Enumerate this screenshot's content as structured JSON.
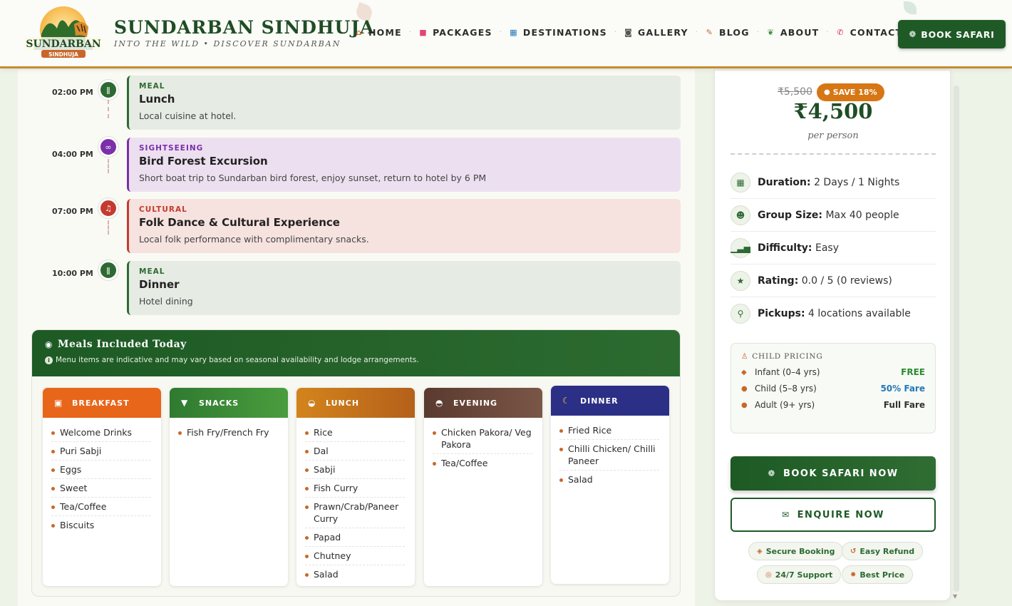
{
  "header": {
    "brand_name": "SUNDARBAN SINDHUJA",
    "brand_tagline": "INTO THE WILD  •  DISCOVER SUNDARBAN",
    "logo_text": "SUNDARBAN",
    "logo_subtext": "SINDHUJA",
    "nav": [
      {
        "label": "HOME",
        "icon": "home-icon"
      },
      {
        "label": "PACKAGES",
        "icon": "package-icon"
      },
      {
        "label": "DESTINATIONS",
        "icon": "map-icon"
      },
      {
        "label": "GALLERY",
        "icon": "camera-icon"
      },
      {
        "label": "BLOG",
        "icon": "blog-icon"
      },
      {
        "label": "ABOUT",
        "icon": "leaf-icon"
      },
      {
        "label": "CONTACT",
        "icon": "phone-icon"
      }
    ],
    "book_button": "BOOK SAFARI"
  },
  "timeline": [
    {
      "time": "02:00 PM",
      "category": "MEAL",
      "title": "Lunch",
      "description": "Local cuisine at hotel.",
      "icon": "utensils-icon",
      "color": "#2d6a32"
    },
    {
      "time": "04:00 PM",
      "category": "SIGHTSEEING",
      "title": "Bird Forest Excursion",
      "description": "Short boat trip to Sundarban bird forest, enjoy sunset, return to hotel by 6 PM",
      "icon": "binoculars-icon",
      "color": "#7b2fa8"
    },
    {
      "time": "07:00 PM",
      "category": "CULTURAL",
      "title": "Folk Dance & Cultural Experience",
      "description": "Local folk performance with complimentary snacks.",
      "icon": "music-icon",
      "color": "#c53a2e"
    },
    {
      "time": "10:00 PM",
      "category": "MEAL",
      "title": "Dinner",
      "description": "Hotel dining",
      "icon": "utensils-icon",
      "color": "#2d6a32"
    }
  ],
  "meals": {
    "title": "Meals Included Today",
    "note": "Menu items are indicative and may vary based on seasonal availability and lodge arrangements.",
    "columns": [
      {
        "label": "BREAKFAST",
        "icon": "sunrise-icon",
        "color": "#e8661a",
        "items": [
          "Welcome Drinks",
          "Puri Sabji",
          "Eggs",
          "Sweet",
          "Tea/Coffee",
          "Biscuits"
        ]
      },
      {
        "label": "SNACKS",
        "icon": "cup-icon",
        "color": "#3e8f3a",
        "items": [
          "Fish Fry/French Fry"
        ]
      },
      {
        "label": "LUNCH",
        "icon": "bowl-icon",
        "color": "#c8741a",
        "items": [
          "Rice",
          "Dal",
          "Sabji",
          "Fish Curry",
          "Prawn/Crab/Paneer Curry",
          "Papad",
          "Chutney",
          "Salad"
        ]
      },
      {
        "label": "EVENING",
        "icon": "tea-icon",
        "color": "#6b4a3d",
        "items": [
          "Chicken Pakora/ Veg Pakora",
          "Tea/Coffee"
        ]
      },
      {
        "label": "DINNER",
        "icon": "moon-icon",
        "color": "#2b2f86",
        "items": [
          "Fried Rice",
          "Chilli Chicken/ Chilli Paneer",
          "Salad"
        ]
      }
    ]
  },
  "sidebar": {
    "price_old": "₹5,500",
    "save_badge": "SAVE 18%",
    "price_new": "₹4,500",
    "price_unit": "per person",
    "info": [
      {
        "label": "Duration:",
        "value": "2 Days / 1 Nights",
        "icon": "calendar-icon"
      },
      {
        "label": "Group Size:",
        "value": "Max 40 people",
        "icon": "users-icon"
      },
      {
        "label": "Difficulty:",
        "value": "Easy",
        "icon": "signal-icon"
      },
      {
        "label": "Rating:",
        "value": "0.0 / 5 (0 reviews)",
        "icon": "star-icon"
      },
      {
        "label": "Pickups:",
        "value": "4 locations available",
        "icon": "location-icon"
      }
    ],
    "child_pricing": {
      "title": "CHILD PRICING",
      "rows": [
        {
          "label": "Infant (0–4 yrs)",
          "price": "FREE"
        },
        {
          "label": "Child (5–8 yrs)",
          "price": "50% Fare"
        },
        {
          "label": "Adult (9+ yrs)",
          "price": "Full Fare"
        }
      ]
    },
    "book_now": "BOOK SAFARI NOW",
    "enquire_now": "ENQUIRE NOW",
    "trust_badges": [
      "Secure Booking",
      "Easy Refund",
      "24/7 Support",
      "Best Price"
    ]
  }
}
